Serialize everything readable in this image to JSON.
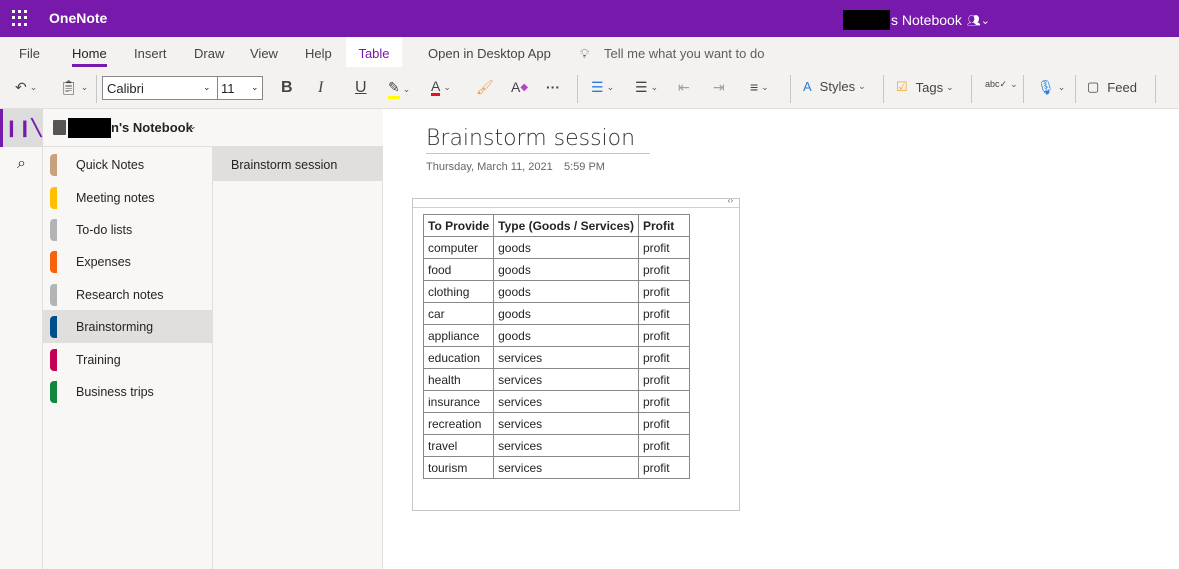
{
  "app": {
    "name": "OneNote",
    "notebook_title_suffix": "s Notebook"
  },
  "ribbon": {
    "tabs": [
      {
        "label": "File"
      },
      {
        "label": "Home",
        "active": true
      },
      {
        "label": "Insert"
      },
      {
        "label": "Draw"
      },
      {
        "label": "View"
      },
      {
        "label": "Help"
      },
      {
        "label": "Table",
        "contextual": true
      }
    ],
    "open_desktop": "Open in Desktop App",
    "tell_me": "Tell me what you want to do",
    "font_name": "Calibri",
    "font_size": "11",
    "bold": "B",
    "italic": "I",
    "underline": "U",
    "more": "···",
    "styles": "Styles",
    "tags": "Tags",
    "feed": "Feed",
    "colors": {
      "highlight": "#ffff00",
      "font_color": "#e81123",
      "accent": "#7719aa"
    }
  },
  "notebook": {
    "name_suffix": "n's Notebook"
  },
  "sections": [
    {
      "label": "Quick Notes",
      "color": "#c8a27c"
    },
    {
      "label": "Meeting notes",
      "color": "#ffc000"
    },
    {
      "label": "To-do lists",
      "color": "#b4b4b4"
    },
    {
      "label": "Expenses",
      "color": "#f7630c"
    },
    {
      "label": "Research notes",
      "color": "#b4b4b4"
    },
    {
      "label": "Brainstorming",
      "color": "#004e8c",
      "selected": true
    },
    {
      "label": "Training",
      "color": "#c30052"
    },
    {
      "label": "Business trips",
      "color": "#10893e"
    }
  ],
  "pages": [
    {
      "label": "Brainstorm session",
      "selected": true
    }
  ],
  "page": {
    "title": "Brainstorm session",
    "date": "Thursday, March 11, 2021",
    "time": "5:59 PM",
    "table": {
      "headers": [
        "To Provide",
        "Type (Goods / Services)",
        "Profit"
      ],
      "rows": [
        [
          "computer",
          "goods",
          "profit"
        ],
        [
          "food",
          "goods",
          "profit"
        ],
        [
          "clothing",
          "goods",
          "profit"
        ],
        [
          "car",
          "goods",
          "profit"
        ],
        [
          "appliance",
          "goods",
          "profit"
        ],
        [
          "education",
          "services",
          "profit"
        ],
        [
          "health",
          "services",
          "profit"
        ],
        [
          "insurance",
          "services",
          "profit"
        ],
        [
          "recreation",
          "services",
          "profit"
        ],
        [
          "travel",
          "services",
          "profit"
        ],
        [
          "tourism",
          "services",
          "profit"
        ]
      ]
    }
  }
}
